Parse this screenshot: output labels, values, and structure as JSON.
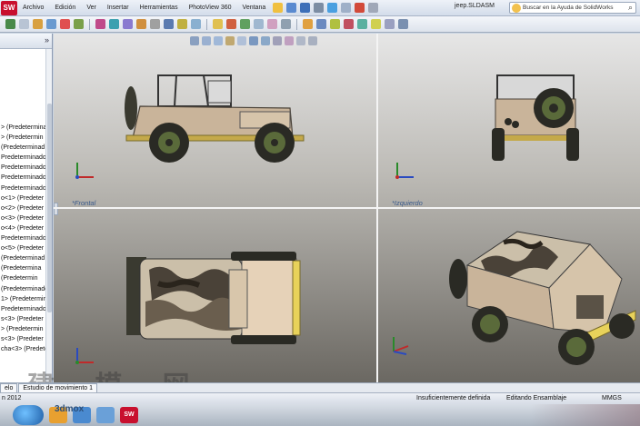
{
  "menu": {
    "items": [
      "Archivo",
      "Edición",
      "Ver",
      "Insertar",
      "Herramientas",
      "PhotoView 360",
      "Ventana"
    ]
  },
  "document": {
    "title": "jeep.SLDASM"
  },
  "help_search": {
    "placeholder": "Buscar en la Ayuda de SolidWorks"
  },
  "tree": {
    "items": [
      "> (Predetermina",
      "> (Predetermin",
      "(Predeterminad",
      "Predeterminado",
      "Predeterminado",
      "Predeterminado",
      "Predeterminado",
      "o<1> (Predeter",
      "o<2> (Predeter",
      "o<3> (Predeter",
      "o<4> (Predeter",
      "Predeterminado",
      "o<5> (Predeter",
      "(Predeterminad",
      "(Predetermina",
      "(Predetermin",
      "(Predeterminado",
      "1> (Predetermin",
      "Predeterminado",
      "s<3> (Predeter",
      "> (Predetermin",
      "s<3> (Predeter",
      "cha<3> (Predeter"
    ]
  },
  "views": {
    "front": "*Frontal",
    "left": "*Izquierdo"
  },
  "tabs": {
    "items": [
      "elo",
      "Estudio de movimiento 1"
    ]
  },
  "status": {
    "left": "n 2012",
    "definition": "Insuficientemente definida",
    "mode": "Editando Ensamblaje",
    "units": "MMGS"
  },
  "watermark": {
    "site": "3dmox",
    "cjk": "建 模 网"
  },
  "colors": {
    "jeep_body": "#c9b49a",
    "jeep_dark": "#3a3a30",
    "wheel_green": "#5a6a3a",
    "bumper_yellow": "#e8d25a",
    "camo_light": "#cbbfa9",
    "camo_dark": "#4a4238",
    "view_label": "#3a5a8a"
  }
}
